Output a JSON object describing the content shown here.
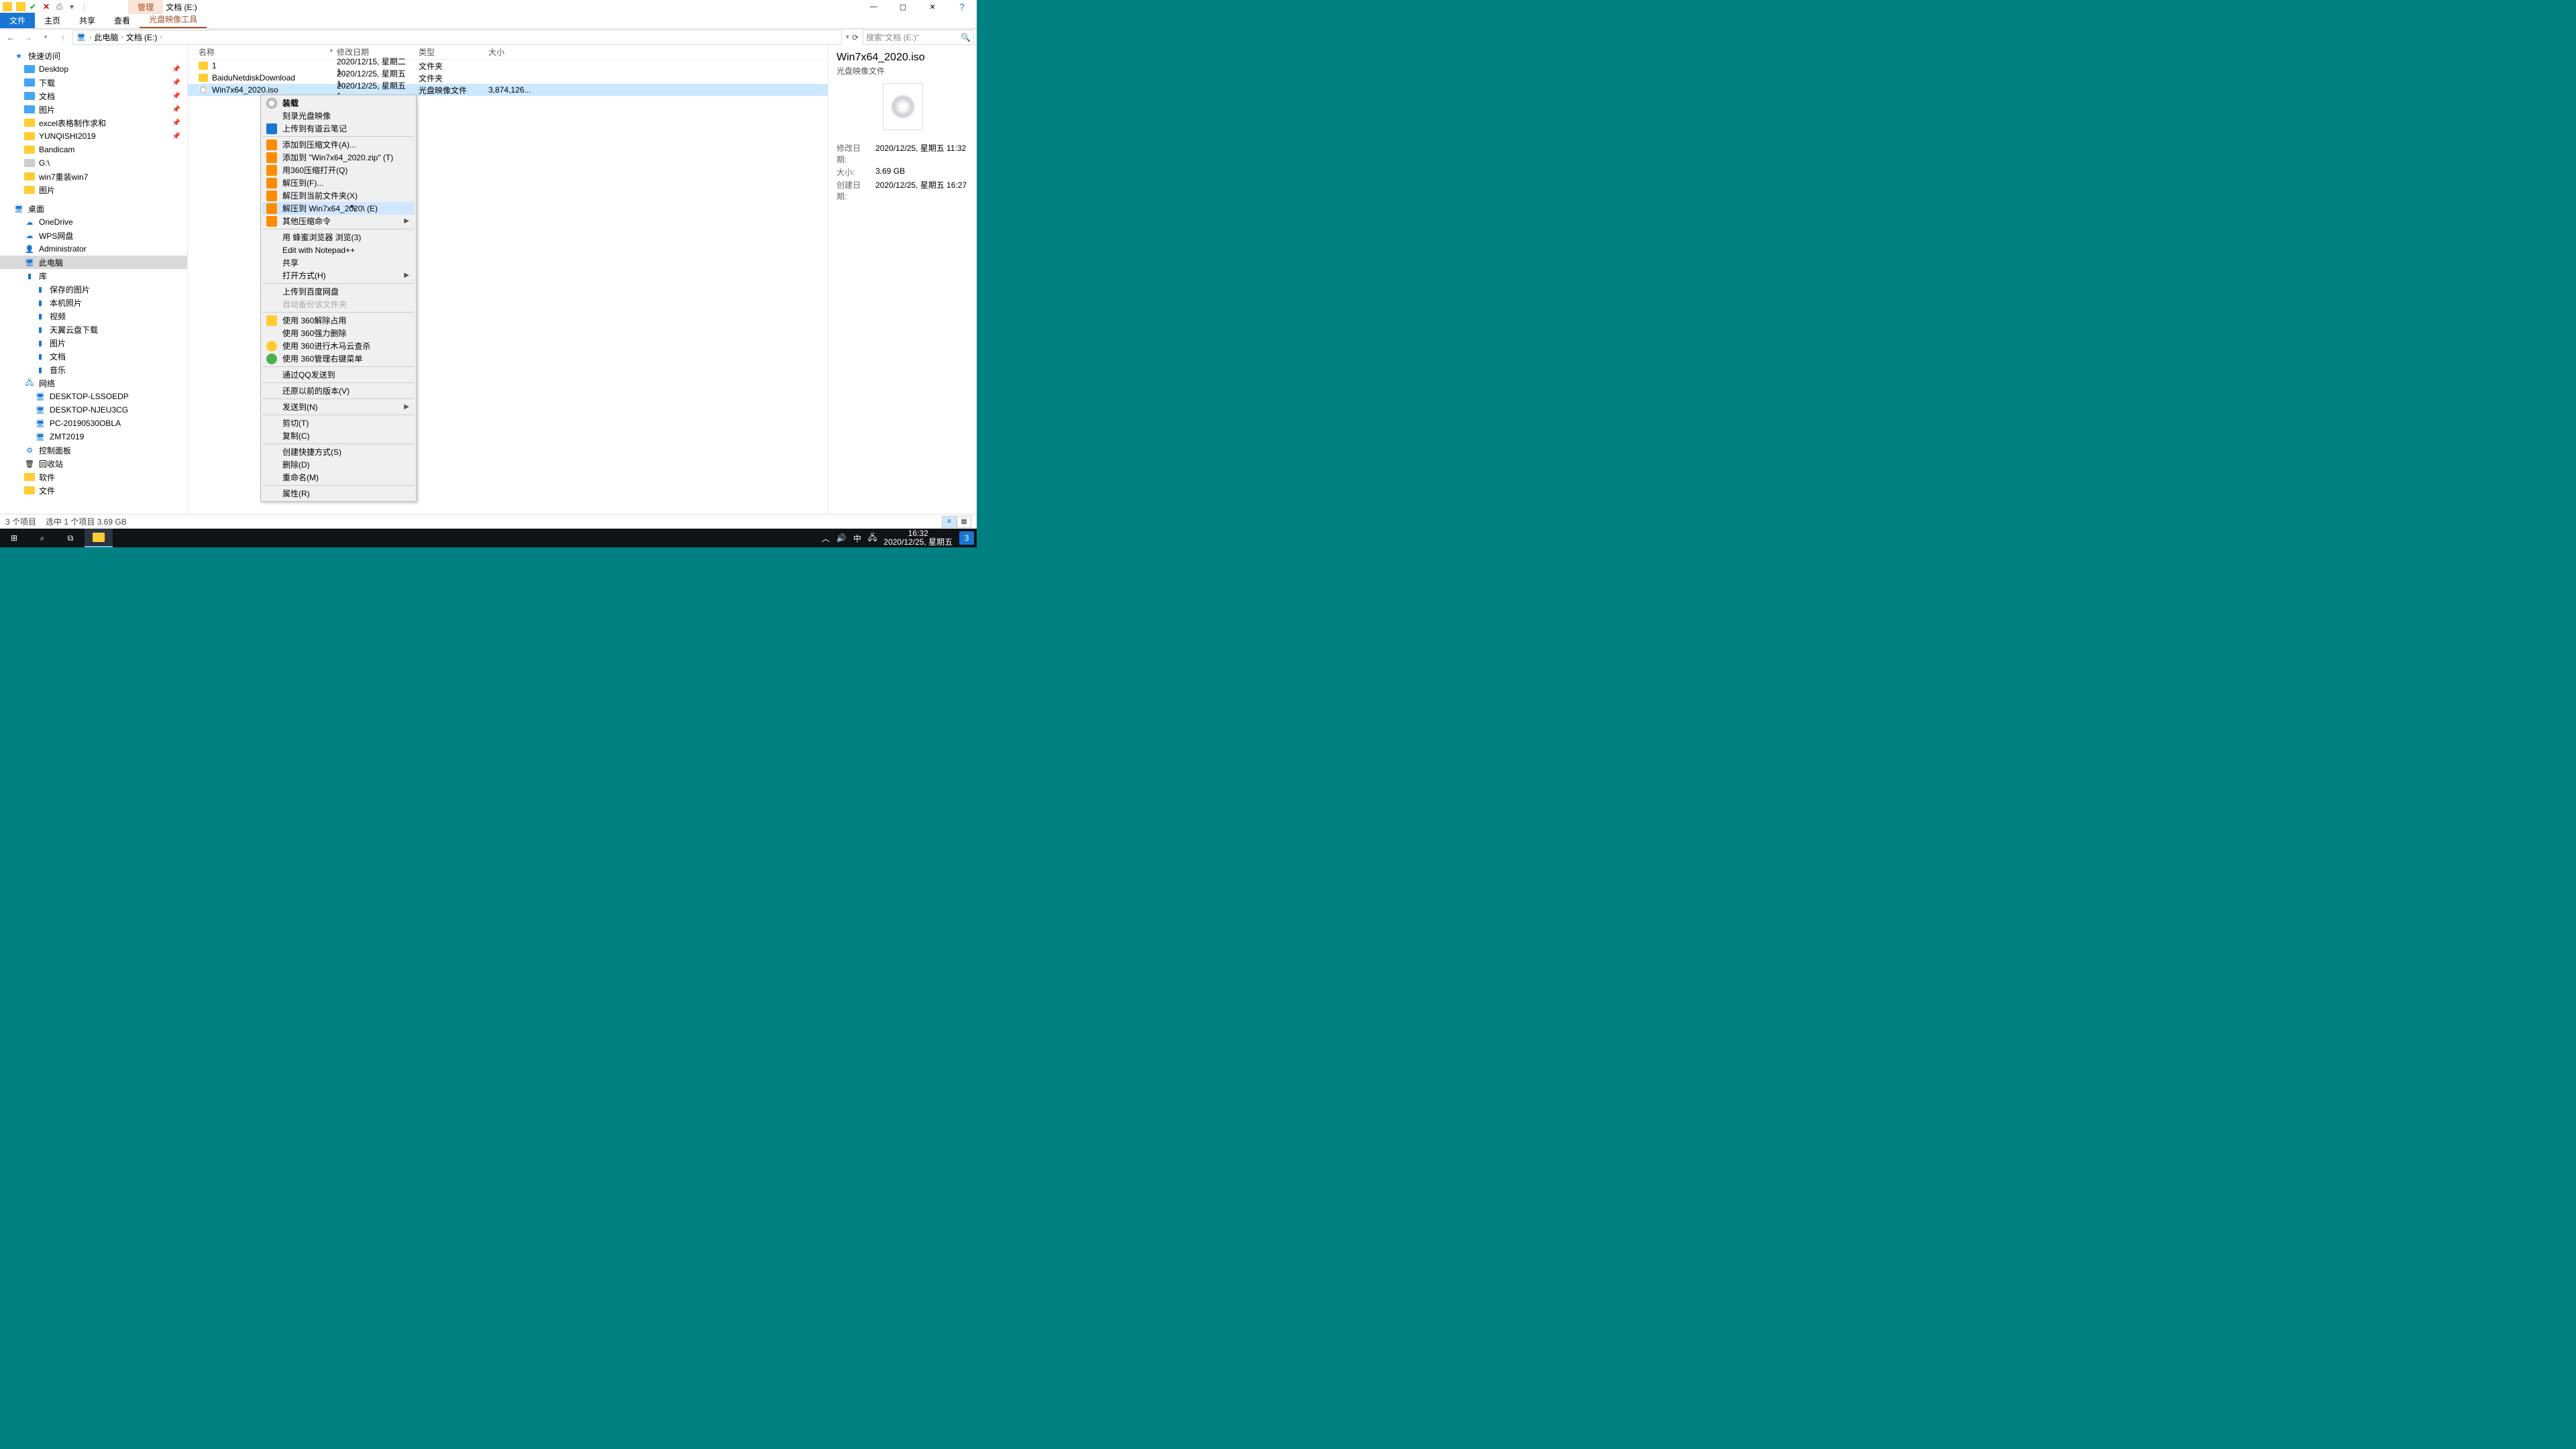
{
  "title_main": "文档 (E:)",
  "title_context_tab": "管理",
  "ribbon": {
    "file": "文件",
    "tabs": [
      "主页",
      "共享",
      "查看"
    ],
    "context_tab": "光盘映像工具"
  },
  "breadcrumb": [
    "此电脑",
    "文档 (E:)"
  ],
  "search_placeholder": "搜索\"文档 (E:)\"",
  "tree": {
    "quick_access": "快速访问",
    "quick_items": [
      "Desktop",
      "下载",
      "文档",
      "图片",
      "excel表格制作求和",
      "YUNQISHI2019",
      "Bandicam",
      "G:\\",
      "win7重装win7",
      "图片"
    ],
    "desktop": "桌面",
    "desktop_items": [
      "OneDrive",
      "WPS网盘",
      "Administrator",
      "此电脑",
      "库"
    ],
    "lib_items": [
      "保存的图片",
      "本机照片",
      "视频",
      "天翼云盘下载",
      "图片",
      "文档",
      "音乐"
    ],
    "network": "网络",
    "net_items": [
      "DESKTOP-LSSOEDP",
      "DESKTOP-NJEU3CG",
      "PC-20190530OBLA",
      "ZMT2019"
    ],
    "control_panel": "控制面板",
    "recycle": "回收站",
    "soft": "软件",
    "files": "文件"
  },
  "columns": {
    "name": "名称",
    "date": "修改日期",
    "type": "类型",
    "size": "大小"
  },
  "rows": [
    {
      "name": "1",
      "date": "2020/12/15, 星期二 1...",
      "type": "文件夹",
      "size": "",
      "icon": "folder"
    },
    {
      "name": "BaiduNetdiskDownload",
      "date": "2020/12/25, 星期五 1...",
      "type": "文件夹",
      "size": "",
      "icon": "folder"
    },
    {
      "name": "Win7x64_2020.iso",
      "date": "2020/12/25, 星期五 1...",
      "type": "光盘映像文件",
      "size": "3,874,126...",
      "icon": "disc",
      "selected": true
    }
  ],
  "context_menu": [
    {
      "label": "装载",
      "bold": true,
      "icon": "disc"
    },
    {
      "label": "刻录光盘映像"
    },
    {
      "label": "上传到有道云笔记",
      "icon": "ydnote"
    },
    {
      "sep": true
    },
    {
      "label": "添加到压缩文件(A)...",
      "icon": "book"
    },
    {
      "label": "添加到 \"Win7x64_2020.zip\" (T)",
      "icon": "book"
    },
    {
      "label": "用360压缩打开(Q)",
      "icon": "book"
    },
    {
      "label": "解压到(F)...",
      "icon": "book"
    },
    {
      "label": "解压到当前文件夹(X)",
      "icon": "book"
    },
    {
      "label": "解压到 Win7x64_2020\\ (E)",
      "icon": "book",
      "highlighted": true
    },
    {
      "label": "其他压缩命令",
      "icon": "book",
      "submenu": true
    },
    {
      "sep": true
    },
    {
      "label": "用 蜂蜜浏览器 浏览(3)",
      "icon": "bee"
    },
    {
      "label": "Edit with Notepad++",
      "icon": "np"
    },
    {
      "label": "共享",
      "icon": "share"
    },
    {
      "label": "打开方式(H)",
      "submenu": true
    },
    {
      "sep": true
    },
    {
      "label": "上传到百度网盘"
    },
    {
      "label": "自动备份该文件夹",
      "disabled": true
    },
    {
      "sep": true
    },
    {
      "label": "使用 360解除占用",
      "icon": "colored"
    },
    {
      "label": "使用 360强力删除",
      "icon": "trash"
    },
    {
      "label": "使用 360进行木马云查杀",
      "icon": "q360y"
    },
    {
      "label": "使用 360管理右键菜单",
      "icon": "q360g"
    },
    {
      "sep": true
    },
    {
      "label": "通过QQ发送到"
    },
    {
      "sep": true
    },
    {
      "label": "还原以前的版本(V)"
    },
    {
      "sep": true
    },
    {
      "label": "发送到(N)",
      "submenu": true
    },
    {
      "sep": true
    },
    {
      "label": "剪切(T)"
    },
    {
      "label": "复制(C)"
    },
    {
      "sep": true
    },
    {
      "label": "创建快捷方式(S)"
    },
    {
      "label": "删除(D)"
    },
    {
      "label": "重命名(M)"
    },
    {
      "sep": true
    },
    {
      "label": "属性(R)"
    }
  ],
  "details": {
    "title": "Win7x64_2020.iso",
    "subtitle": "光盘映像文件",
    "meta": [
      {
        "k": "修改日期:",
        "v": "2020/12/25, 星期五 11:32"
      },
      {
        "k": "大小:",
        "v": "3.69 GB"
      },
      {
        "k": "创建日期:",
        "v": "2020/12/25, 星期五 16:27"
      }
    ]
  },
  "status": {
    "items": "3 个项目",
    "selected": "选中 1 个项目  3.69 GB"
  },
  "taskbar": {
    "ime": "中",
    "time": "16:32",
    "date": "2020/12/25, 星期五",
    "notif": "3"
  }
}
